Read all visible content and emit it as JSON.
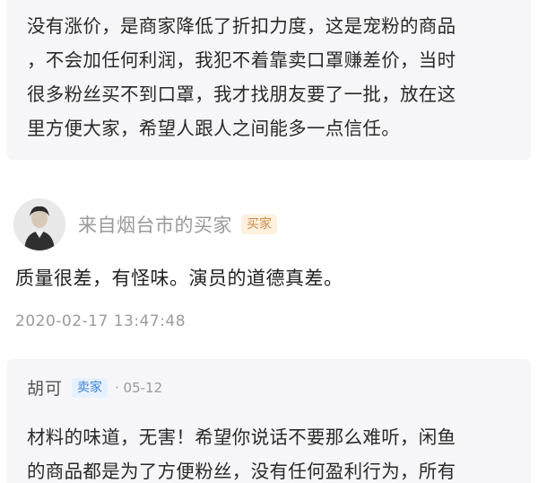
{
  "top_reply": {
    "text": "没有涨价，是商家降低了折扣力度，这是宠粉的商品\n，不会加任何利润，我犯不着靠卖口罩赚差价，当时\n很多粉丝买不到口罩，我才找朋友要了一批，放在这\n里方便大家，希望人跟人之间能多一点信任。"
  },
  "comment": {
    "author": "来自烟台市的买家",
    "badge": "买家",
    "text": "质量很差，有怪味。演员的道德真差。",
    "timestamp": "2020-02-17 13:47:48"
  },
  "bottom_reply": {
    "author": "胡可",
    "badge": "卖家",
    "date": "· 05-12",
    "text": "材料的味道，无害！希望你说话不要那么难听，闲鱼\n的商品都是为了方便粉丝，没有任何盈利行为，所有"
  },
  "colors": {
    "card_bg": "#f6f6f8",
    "muted_text": "#9a9a9a",
    "buyer_badge_bg": "#fff1de",
    "buyer_badge_text": "#c98a4b",
    "seller_badge_bg": "#e6f1ff",
    "seller_badge_text": "#3f84d6"
  }
}
